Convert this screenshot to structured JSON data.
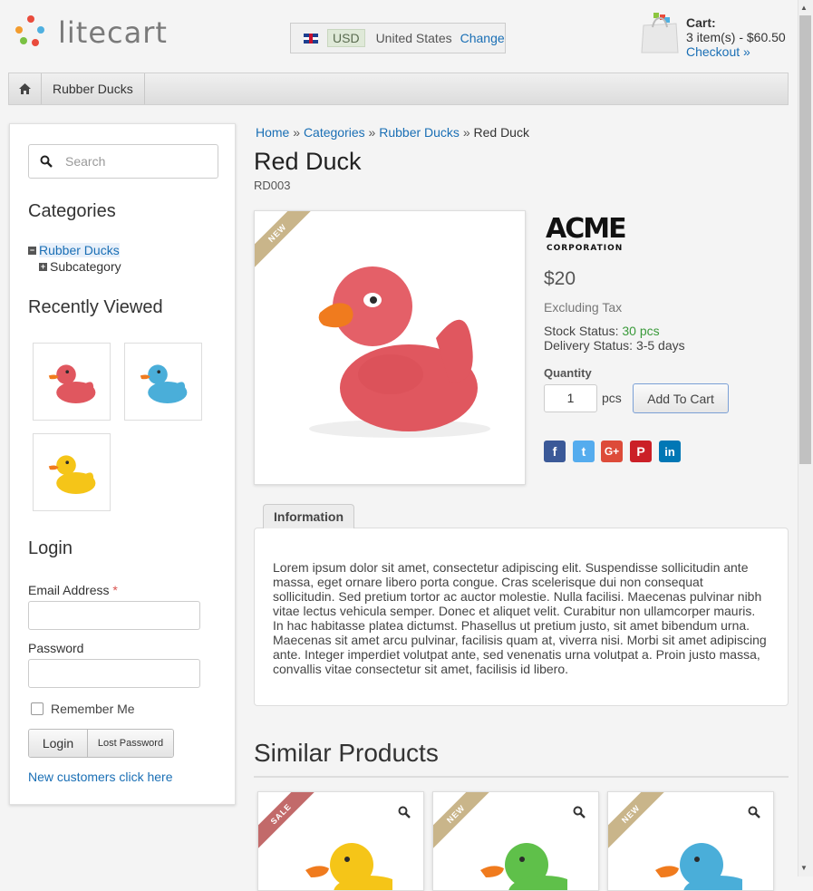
{
  "header": {
    "logo_text": "litecart",
    "currency": "USD",
    "country": "United States",
    "change_label": "Change",
    "cart_title": "Cart:",
    "cart_summary": "3 item(s) - $60.50",
    "checkout_label": "Checkout »"
  },
  "nav": {
    "item": "Rubber Ducks"
  },
  "sidebar": {
    "search_placeholder": "Search",
    "categories_title": "Categories",
    "categories": [
      "Rubber Ducks",
      "Subcategory"
    ],
    "recently_viewed_title": "Recently Viewed",
    "login_title": "Login",
    "email_label": "Email Address",
    "required_mark": "*",
    "password_label": "Password",
    "remember_label": "Remember Me",
    "login_button": "Login",
    "lost_password_button": "Lost Password",
    "new_customers_link": "New customers click here"
  },
  "breadcrumb": {
    "items": [
      "Home",
      "Categories",
      "Rubber Ducks"
    ],
    "separator": "»",
    "current": "Red Duck"
  },
  "product": {
    "title": "Red Duck",
    "sku": "RD003",
    "ribbon": "NEW",
    "manufacturer": "ACME CORPORATION",
    "price": "$20",
    "tax_note": "Excluding Tax",
    "stock_label": "Stock Status:",
    "stock_value": "30 pcs",
    "delivery_label": "Delivery Status:",
    "delivery_value": "3-5 days",
    "quantity_label": "Quantity",
    "quantity_value": "1",
    "unit": "pcs",
    "add_to_cart": "Add To Cart"
  },
  "social": [
    "f",
    "t",
    "G+",
    "P",
    "in"
  ],
  "tab": {
    "label": "Information",
    "description": "Lorem ipsum dolor sit amet, consectetur adipiscing elit. Suspendisse sollicitudin ante massa, eget ornare libero porta congue. Cras scelerisque dui non consequat sollicitudin. Sed pretium tortor ac auctor molestie. Nulla facilisi. Maecenas pulvinar nibh vitae lectus vehicula semper. Donec et aliquet velit. Curabitur non ullamcorper mauris. In hac habitasse platea dictumst. Phasellus ut pretium justo, sit amet bibendum urna. Maecenas sit amet arcu pulvinar, facilisis quam at, viverra nisi. Morbi sit amet adipiscing ante. Integer imperdiet volutpat ante, sed venenatis urna volutpat a. Proin justo massa, convallis vitae consectetur sit amet, facilisis id libero."
  },
  "similar": {
    "title": "Similar Products",
    "items": [
      {
        "ribbon": "SALE",
        "duck_color": "#f5c518"
      },
      {
        "ribbon": "NEW",
        "duck_color": "#5fc04a"
      },
      {
        "ribbon": "NEW",
        "duck_color": "#4aaed9"
      }
    ]
  },
  "colors": {
    "link": "#1a6fb5",
    "in_stock": "#3a9a3a",
    "red_duck": "#e0575f",
    "ribbon_new": "#c9b58a",
    "ribbon_sale": "#c26a6a"
  }
}
